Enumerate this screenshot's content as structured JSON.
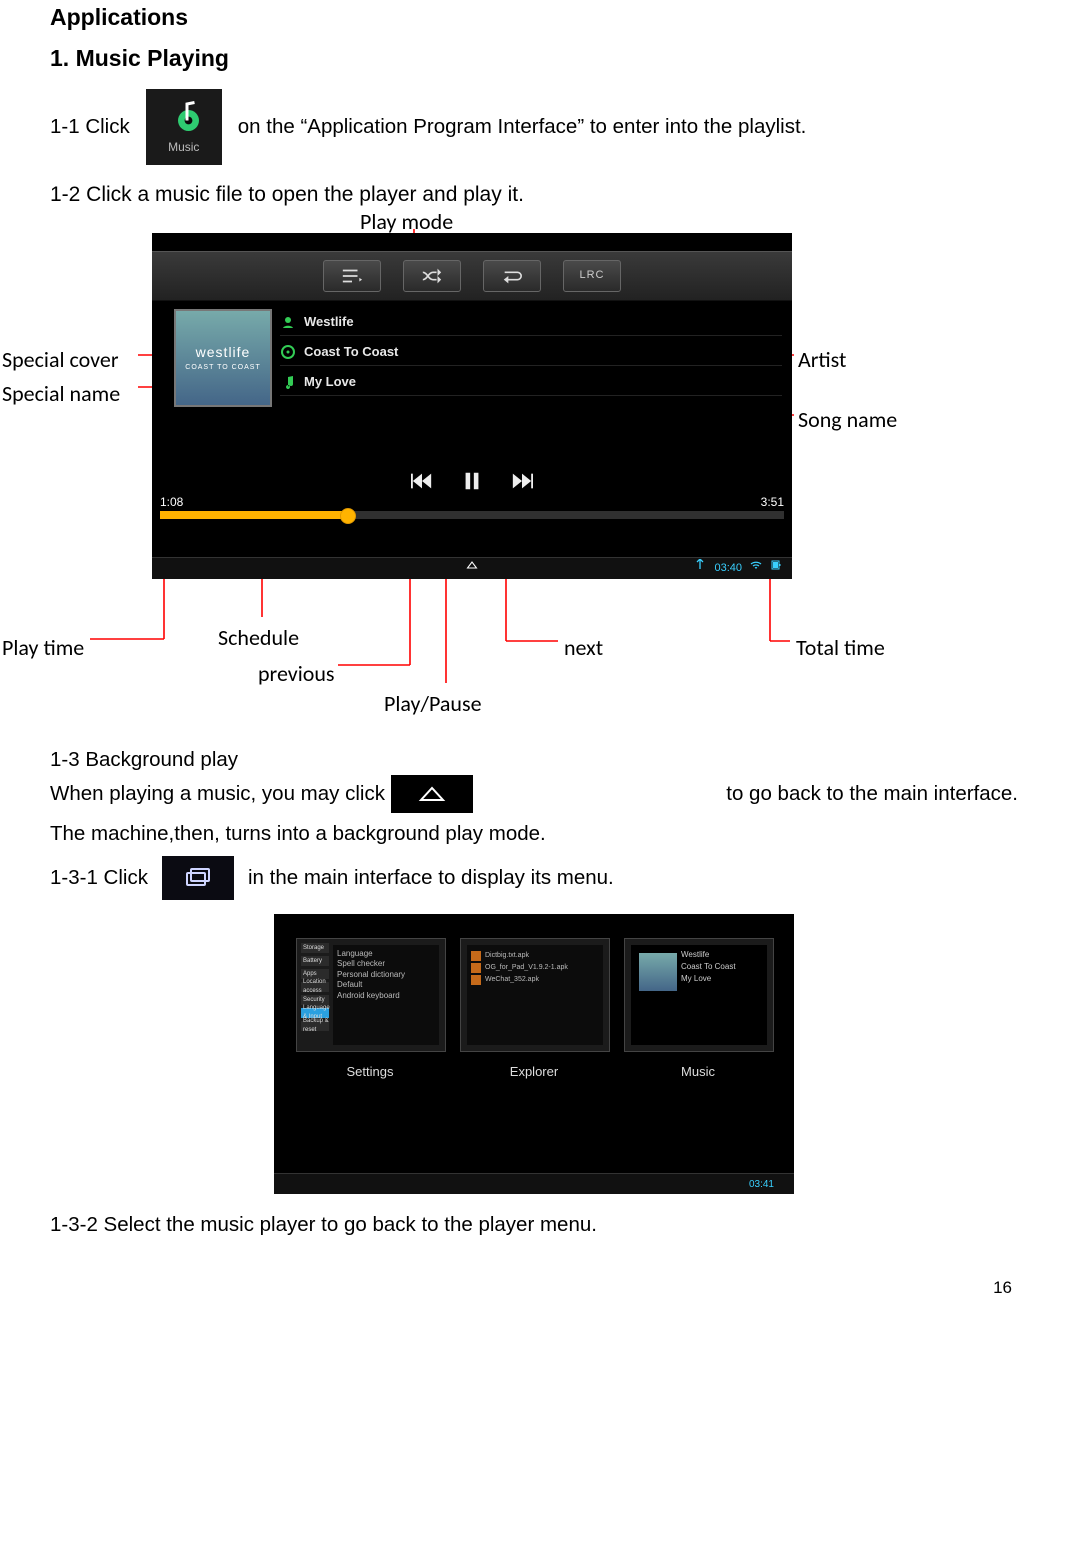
{
  "heading_applications": "Applications",
  "heading_music_playing": "1. Music Playing",
  "line_1_1_a": "1-1 Click",
  "line_1_1_b": "on the “Application Program Interface” to enter into the playlist.",
  "music_icon_label": "Music",
  "line_1_2": "1-2 Click a music file to open the player and play it.",
  "callouts": {
    "play_mode": "Play mode",
    "playlist": "Playlist",
    "random": "Random",
    "special_cover": "Special cover",
    "special_name": "Special name",
    "artist": "Artist",
    "song_name": "Song name",
    "play_time": "Play time",
    "schedule": "Schedule",
    "previous": "previous",
    "play_pause": "Play/Pause",
    "next": "next",
    "total_time": "Total time"
  },
  "player": {
    "lrc": "LRC",
    "artist": "Westlife",
    "album": "Coast To Coast",
    "song": "My Love",
    "cover_band": "westlife",
    "cover_caption": "COAST TO COAST",
    "elapsed": "1:08",
    "total": "3:51",
    "clock": "03:40"
  },
  "sec_1_3_title": "1-3 Background play",
  "sec_1_3_a": "When playing a music, you may click",
  "sec_1_3_b": "to go back to the main interface.",
  "sec_1_3_c": "The machine,then, turns into a background play mode.",
  "sec_1_3_1_a": "1-3-1 Click",
  "sec_1_3_1_b": "in the main interface to display its menu.",
  "recent": {
    "cap1": "Settings",
    "cap2": "Explorer",
    "cap3": "Music",
    "clock": "03:41",
    "settings_items": [
      "Storage",
      "Battery",
      "Apps",
      "Location access",
      "Security",
      "Language & Input",
      "Backup & reset"
    ],
    "settings_right": [
      "Language",
      "Spell checker",
      "Personal dictionary",
      "Default",
      "Android keyboard"
    ],
    "explorer_files": [
      "Dictbig.txt.apk",
      "OG_for_Pad_V1.9.2-1.apk",
      "WeChat_352.apk"
    ],
    "music_lines": [
      "Westlife",
      "Coast To Coast",
      "My Love"
    ]
  },
  "sec_1_3_2": "1-3-2 Select the music player to go back to the player menu.",
  "page_number": "16"
}
